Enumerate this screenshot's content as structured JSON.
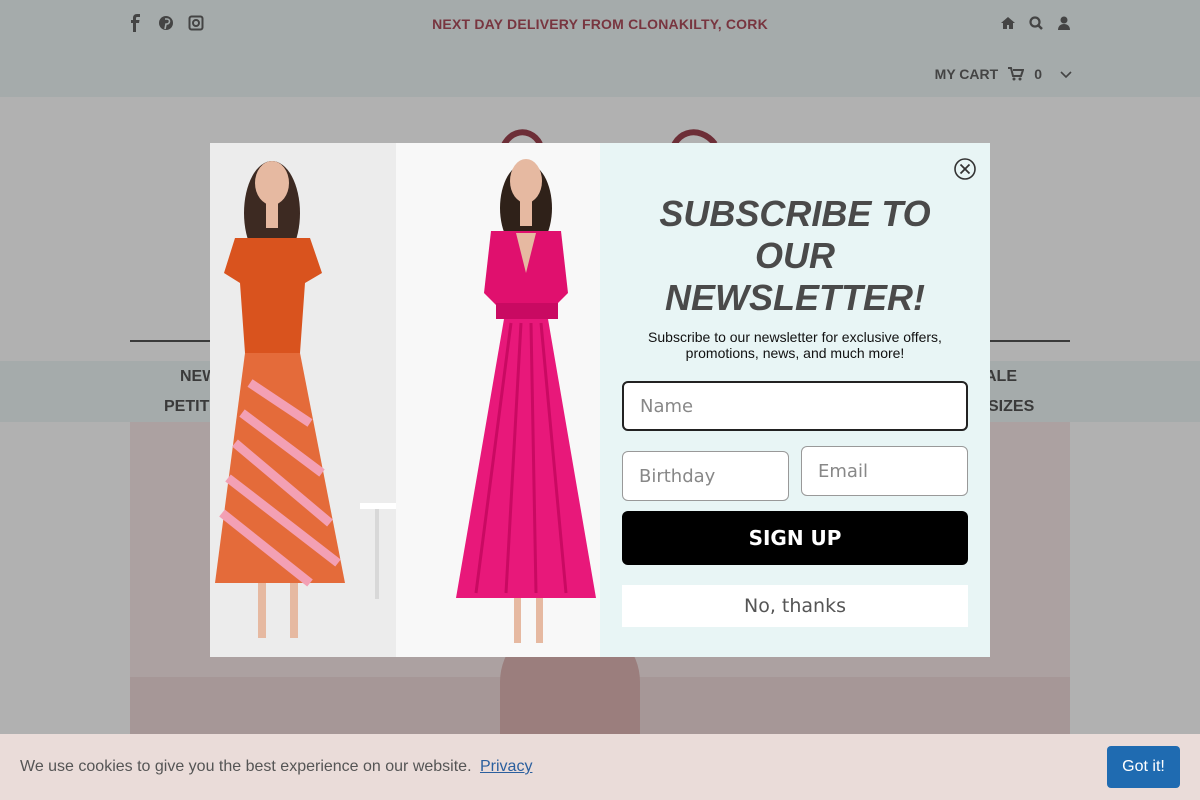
{
  "header": {
    "promo": "NEXT DAY DELIVERY FROM CLONAKILTY, CORK",
    "social_icons": [
      "facebook-icon",
      "pinterest-icon",
      "instagram-icon"
    ],
    "util_icons": [
      "home-icon",
      "search-icon",
      "user-icon"
    ],
    "cart_label": "MY CART",
    "cart_count": "0"
  },
  "nav": {
    "row1_left": "NEW",
    "row1_right": "ALE",
    "row2_left": "PETIT",
    "row2_right": "SIZES"
  },
  "modal": {
    "title_line1": "SUBSCRIBE TO",
    "title_line2": "OUR",
    "title_line3": "NEWSLETTER!",
    "subtitle_line1": "Subscribe to our newsletter for exclusive offers,",
    "subtitle_line2": "promotions, news, and much more!",
    "name_placeholder": "Name",
    "birthday_placeholder": "Birthday",
    "email_placeholder": "Email",
    "signup_label": "SIGN UP",
    "decline_label": "No, thanks"
  },
  "cookie": {
    "text": "We use cookies to give you the best experience on our website.",
    "link": "Privacy",
    "button": "Got it!"
  },
  "colors": {
    "promo_red": "#9e2a3c",
    "modal_bg": "#e8f5f5",
    "signup_bg": "#000000",
    "cookie_button": "#1f6bb1",
    "dress_orange": "#d9531e",
    "dress_pink": "#e0106e"
  }
}
